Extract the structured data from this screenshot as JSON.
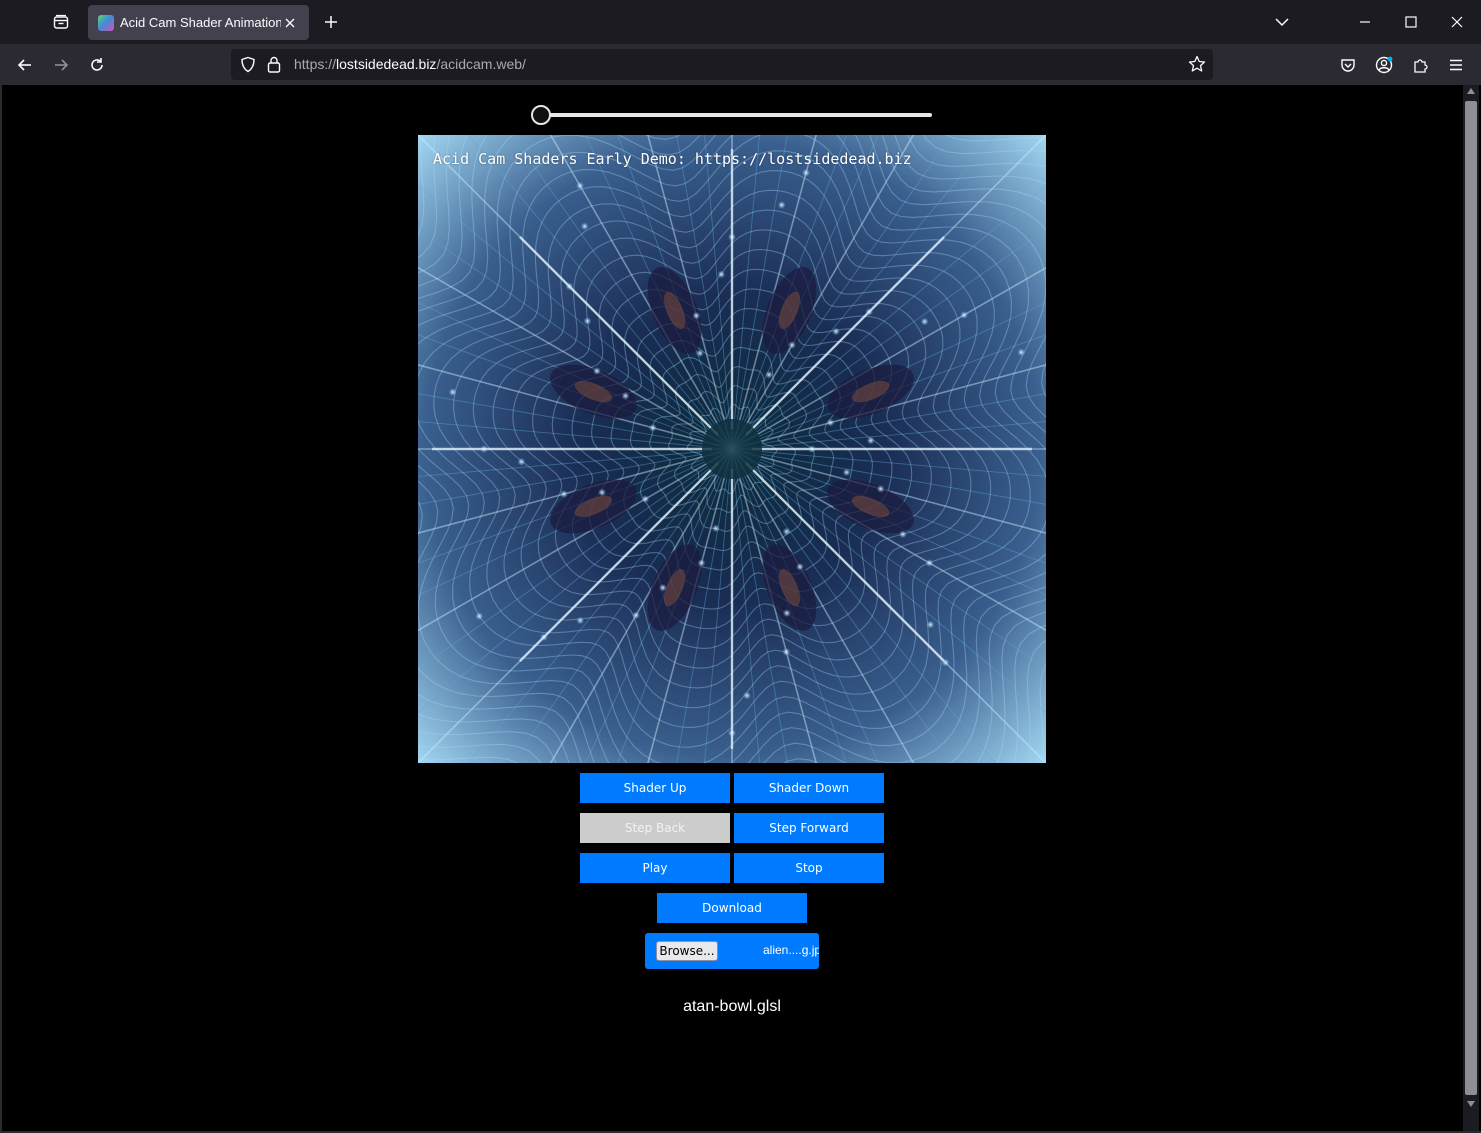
{
  "browser": {
    "tab_title": "Acid Cam Shader Animation",
    "url_prefix": "https://",
    "url_host": "lostsidedead.biz",
    "url_path": "/acidcam.web/"
  },
  "icons": {
    "list_all_tabs": "tab-list-icon",
    "close_tab": "close-icon",
    "new_tab": "plus-icon",
    "back": "arrow-left-icon",
    "forward": "arrow-right-icon",
    "reload": "reload-icon",
    "tracking_protection": "shield-icon",
    "secure": "lock-icon",
    "bookmark": "star-icon",
    "pocket": "pocket-icon",
    "account": "account-icon",
    "extensions": "puzzle-icon",
    "menu": "hamburger-icon"
  },
  "slider": {
    "value_fraction": 0.0
  },
  "canvas": {
    "overlay_text": "Acid Cam Shaders Early Demo: https://lostsidedead.biz"
  },
  "controls": {
    "shader_up": "Shader Up",
    "shader_down": "Shader Down",
    "step_back": "Step Back",
    "step_forward": "Step Forward",
    "play": "Play",
    "stop": "Stop",
    "download": "Download",
    "browse": "Browse...",
    "file_name": "alien....g.jpg"
  },
  "shader_name": "atan-bowl.glsl",
  "colors": {
    "accent_button": "#007bff",
    "disabled_button": "#cccccc",
    "page_background": "#000000"
  }
}
